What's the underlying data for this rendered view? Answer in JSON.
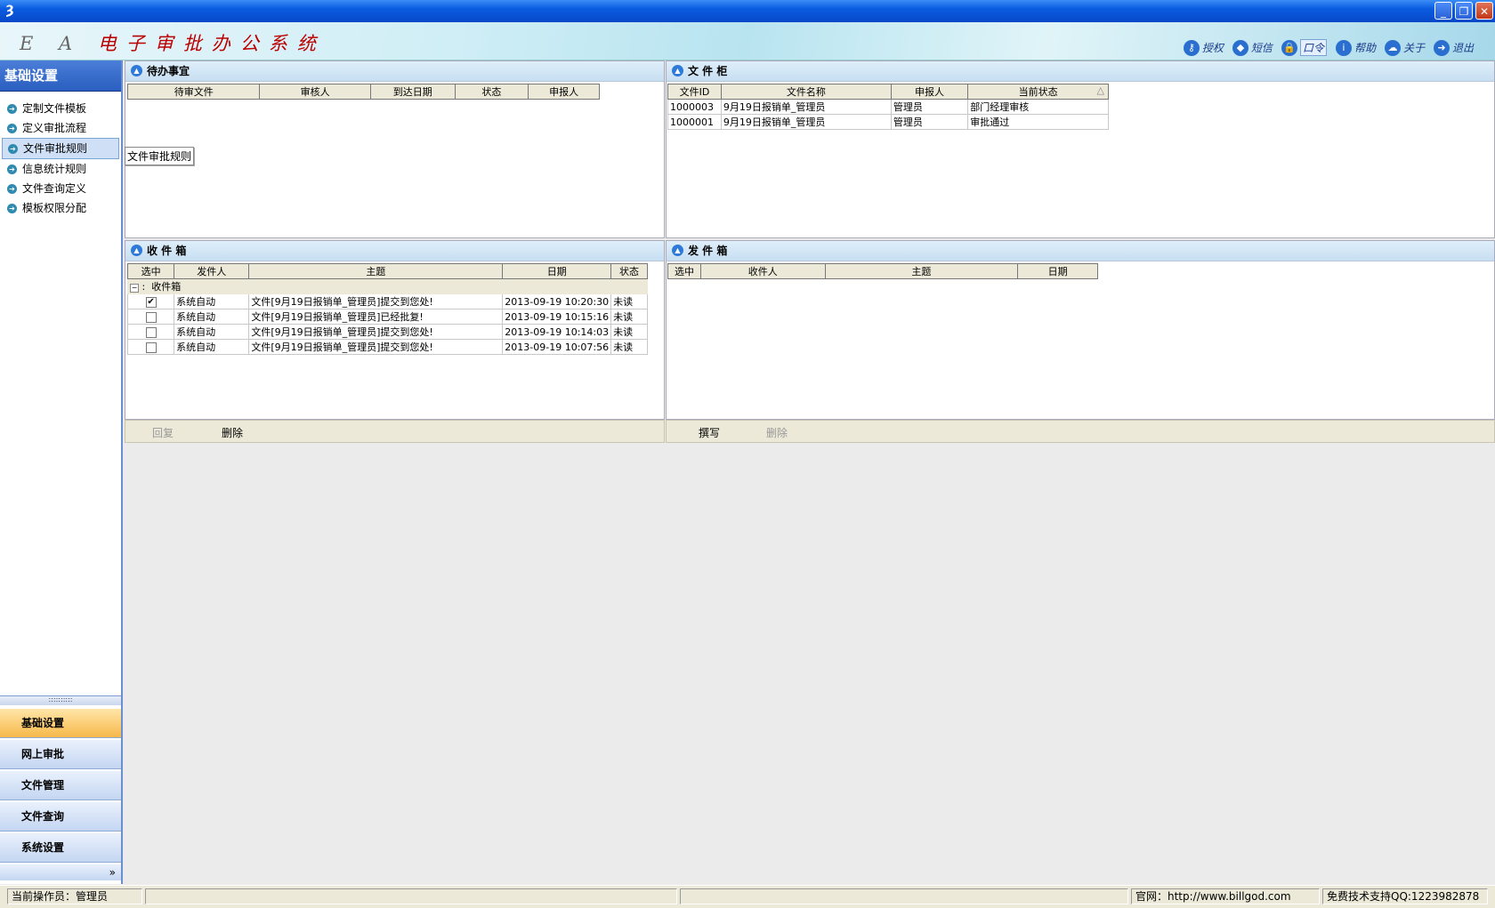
{
  "window": {
    "icon": "ea-app-icon",
    "controls": [
      "_",
      "❐",
      "✕"
    ]
  },
  "banner": {
    "logo_ea": "E A",
    "logo_text": "电子审批办公系统"
  },
  "topnav": [
    {
      "label": "授权",
      "icon": "key-icon"
    },
    {
      "label": "短信",
      "icon": "message-icon"
    },
    {
      "label": "口令",
      "icon": "lock-icon"
    },
    {
      "label": "帮助",
      "icon": "info-icon"
    },
    {
      "label": "关于",
      "icon": "about-icon"
    },
    {
      "label": "退出",
      "icon": "exit-icon"
    }
  ],
  "sidebar": {
    "title": "基础设置",
    "items": [
      "定制文件模板",
      "定义审批流程",
      "文件审批规则",
      "信息统计规则",
      "文件查询定义",
      "模板权限分配"
    ],
    "selected": 2,
    "groups": [
      "基础设置",
      "网上审批",
      "文件管理",
      "文件查询",
      "系统设置"
    ],
    "more": "»"
  },
  "todo": {
    "title": "待办事宜",
    "columns": [
      "待审文件",
      "审核人",
      "到达日期",
      "状态",
      "申报人"
    ],
    "tooltip": "文件审批规则"
  },
  "cabinet": {
    "title": "文 件 柜",
    "columns": [
      "文件ID",
      "文件名称",
      "申报人",
      "当前状态"
    ],
    "sort_indicator": "△",
    "rows": [
      [
        "1000003",
        "9月19日报销单_管理员",
        "管理员",
        "部门经理审核"
      ],
      [
        "1000001",
        "9月19日报销单_管理员",
        "管理员",
        "审批通过"
      ]
    ]
  },
  "inbox": {
    "title": "收 件 箱",
    "columns": [
      "选中",
      "发件人",
      "主题",
      "日期",
      "状态"
    ],
    "group_label": "收件箱",
    "rows": [
      {
        "checked": true,
        "from": "系统自动",
        "subject": "文件[9月19日报销单_管理员]提交到您处!",
        "date": "2013-09-19 10:20:30",
        "status": "未读"
      },
      {
        "checked": false,
        "from": "系统自动",
        "subject": "文件[9月19日报销单_管理员]已经批复!",
        "date": "2013-09-19 10:15:16",
        "status": "未读"
      },
      {
        "checked": false,
        "from": "系统自动",
        "subject": "文件[9月19日报销单_管理员]提交到您处!",
        "date": "2013-09-19 10:14:03",
        "status": "未读"
      },
      {
        "checked": false,
        "from": "系统自动",
        "subject": "文件[9月19日报销单_管理员]提交到您处!",
        "date": "2013-09-19 10:07:56",
        "status": "未读"
      }
    ],
    "actions": {
      "reply": "回复",
      "delete": "删除"
    }
  },
  "outbox": {
    "title": "发 件 箱",
    "columns": [
      "选中",
      "收件人",
      "主题",
      "日期"
    ],
    "actions": {
      "compose": "撰写",
      "delete": "删除"
    }
  },
  "status": {
    "operator": "当前操作员：管理员",
    "website": "官网：http://www.billgod.com",
    "support": "免费技术支持QQ:1223982878"
  }
}
